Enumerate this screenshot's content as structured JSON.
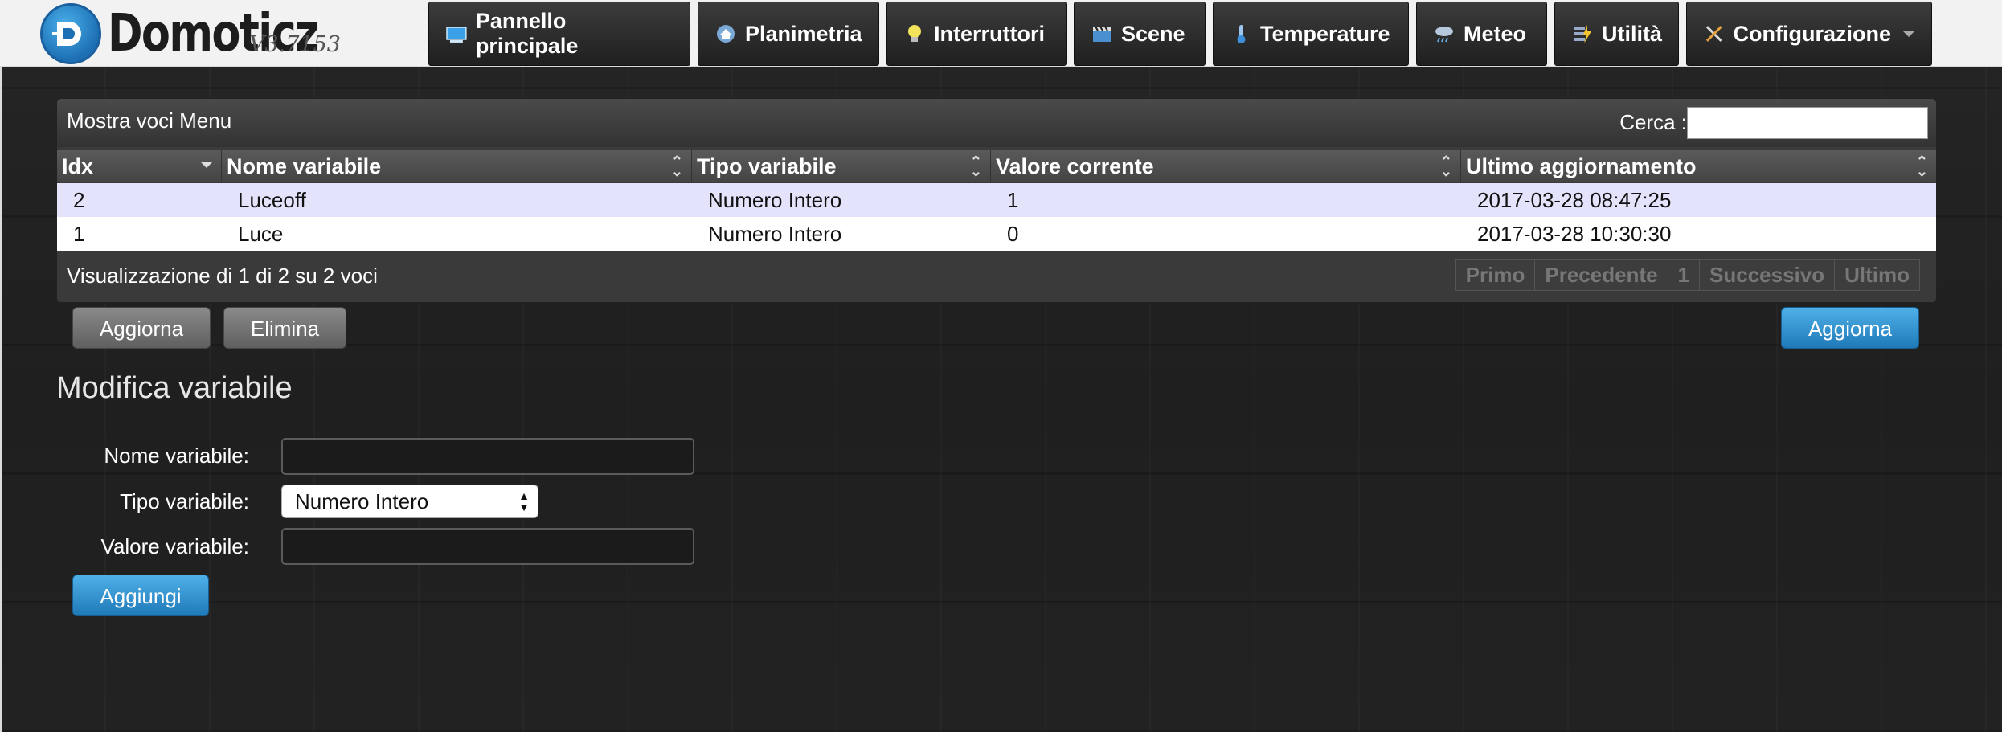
{
  "app": {
    "name": "Domoticz",
    "version": "V3.7153"
  },
  "nav": [
    {
      "label": "Pannello principale",
      "icon": "dashboard-icon"
    },
    {
      "label": "Planimetria",
      "icon": "floorplan-icon"
    },
    {
      "label": "Interruttori",
      "icon": "lightbulb-icon"
    },
    {
      "label": "Scene",
      "icon": "clapperboard-icon"
    },
    {
      "label": "Temperature",
      "icon": "thermometer-icon"
    },
    {
      "label": "Meteo",
      "icon": "weather-icon"
    },
    {
      "label": "Utilità",
      "icon": "utility-icon"
    },
    {
      "label": "Configurazione",
      "icon": "tools-icon"
    }
  ],
  "table": {
    "show_menu": "Mostra voci Menu",
    "search_label": "Cerca :",
    "search_value": "",
    "columns": [
      "Idx",
      "Nome variabile",
      "Tipo variabile",
      "Valore corrente",
      "Ultimo aggiornamento"
    ],
    "rows": [
      [
        "2",
        "Luceoff",
        "Numero Intero",
        "1",
        "2017-03-28 08:47:25"
      ],
      [
        "1",
        "Luce",
        "Numero Intero",
        "0",
        "2017-03-28 10:30:30"
      ]
    ],
    "info": "Visualizzazione di 1 di 2 su 2 voci",
    "pager": {
      "first": "Primo",
      "prev": "Precedente",
      "page": "1",
      "next": "Successivo",
      "last": "Ultimo"
    }
  },
  "buttons": {
    "update": "Aggiorna",
    "delete": "Elimina",
    "update_right": "Aggiorna",
    "add": "Aggiungi"
  },
  "form": {
    "title": "Modifica variabile",
    "name_label": "Nome variabile:",
    "name_value": "",
    "type_label": "Tipo variabile:",
    "type_selected": "Numero Intero",
    "value_label": "Valore variabile:",
    "value_value": ""
  },
  "colors": {
    "row_highlight": "#e3e3fb",
    "row_normal": "#ffffff",
    "accent_blue": "#2a88c8"
  }
}
